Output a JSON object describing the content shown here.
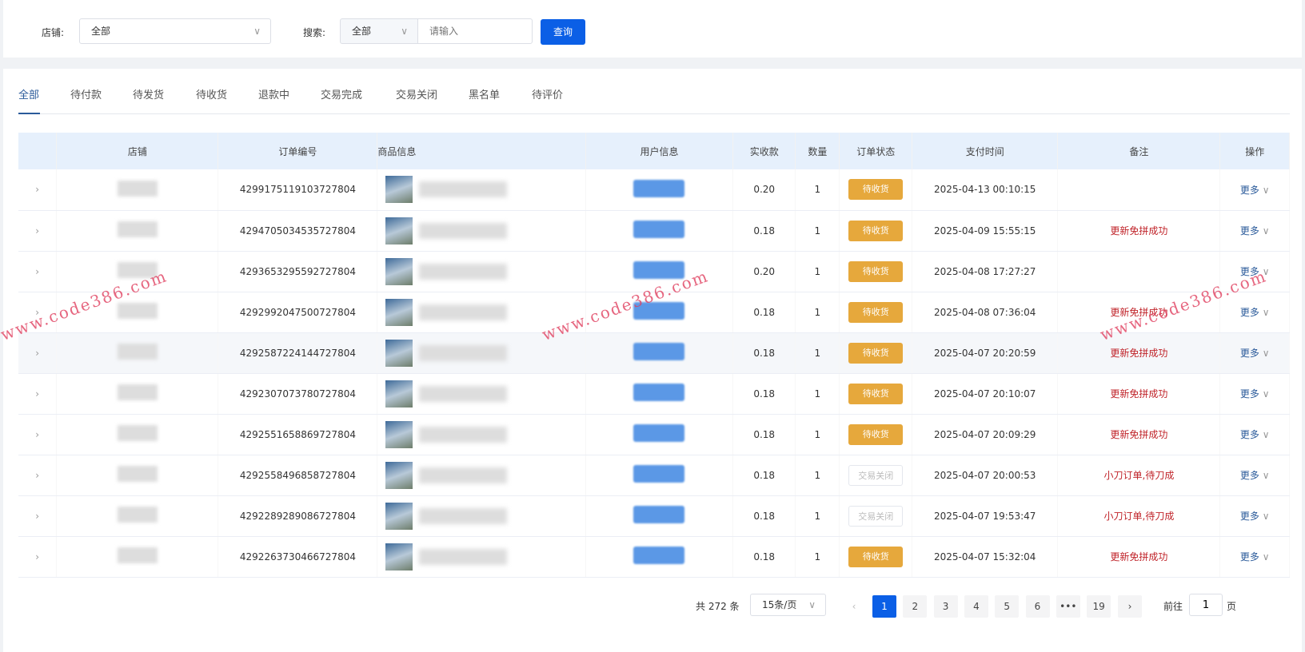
{
  "filter": {
    "shop_label": "店铺:",
    "shop_value": "全部",
    "search_label": "搜索:",
    "search_type": "全部",
    "search_placeholder": "请输入",
    "query_button": "查询"
  },
  "tabs": [
    "全部",
    "待付款",
    "待发货",
    "待收货",
    "退款中",
    "交易完成",
    "交易关闭",
    "黑名单",
    "待评价"
  ],
  "table": {
    "headers": [
      "店铺",
      "订单编号",
      "商品信息",
      "用户信息",
      "实收款",
      "数量",
      "订单状态",
      "支付时间",
      "备注",
      "操作"
    ],
    "rows": [
      {
        "order_no": "4299175119103727804",
        "amount": "0.20",
        "qty": "1",
        "status": "待收货",
        "status_type": "wait",
        "time": "2025-04-13 00:10:15",
        "note": "",
        "action": "更多"
      },
      {
        "order_no": "4294705034535727804",
        "amount": "0.18",
        "qty": "1",
        "status": "待收货",
        "status_type": "wait",
        "time": "2025-04-09 15:55:15",
        "note": "更新免拼成功",
        "action": "更多"
      },
      {
        "order_no": "4293653295592727804",
        "amount": "0.20",
        "qty": "1",
        "status": "待收货",
        "status_type": "wait",
        "time": "2025-04-08 17:27:27",
        "note": "",
        "action": "更多"
      },
      {
        "order_no": "4292992047500727804",
        "amount": "0.18",
        "qty": "1",
        "status": "待收货",
        "status_type": "wait",
        "time": "2025-04-08 07:36:04",
        "note": "更新免拼成功",
        "action": "更多"
      },
      {
        "order_no": "4292587224144727804",
        "amount": "0.18",
        "qty": "1",
        "status": "待收货",
        "status_type": "wait",
        "time": "2025-04-07 20:20:59",
        "note": "更新免拼成功",
        "action": "更多"
      },
      {
        "order_no": "4292307073780727804",
        "amount": "0.18",
        "qty": "1",
        "status": "待收货",
        "status_type": "wait",
        "time": "2025-04-07 20:10:07",
        "note": "更新免拼成功",
        "action": "更多"
      },
      {
        "order_no": "4292551658869727804",
        "amount": "0.18",
        "qty": "1",
        "status": "待收货",
        "status_type": "wait",
        "time": "2025-04-07 20:09:29",
        "note": "更新免拼成功",
        "action": "更多"
      },
      {
        "order_no": "4292558496858727804",
        "amount": "0.18",
        "qty": "1",
        "status": "交易关闭",
        "status_type": "closed",
        "time": "2025-04-07 20:00:53",
        "note": "小刀订单,待刀成",
        "action": "更多"
      },
      {
        "order_no": "4292289289086727804",
        "amount": "0.18",
        "qty": "1",
        "status": "交易关闭",
        "status_type": "closed",
        "time": "2025-04-07 19:53:47",
        "note": "小刀订单,待刀成",
        "action": "更多"
      },
      {
        "order_no": "4292263730466727804",
        "amount": "0.18",
        "qty": "1",
        "status": "待收货",
        "status_type": "wait",
        "time": "2025-04-07 15:32:04",
        "note": "更新免拼成功",
        "action": "更多"
      }
    ]
  },
  "pagination": {
    "total": "共 272 条",
    "page_size": "15条/页",
    "pages": [
      "1",
      "2",
      "3",
      "4",
      "5",
      "6",
      "•••",
      "19"
    ],
    "current": "1",
    "goto_label": "前往",
    "goto_value": "1",
    "goto_suffix": "页"
  },
  "watermark": "www.code386.com",
  "colors": {
    "primary": "#0b5fe6",
    "status_wait": "#e6a83c",
    "note": "#c0242a"
  }
}
